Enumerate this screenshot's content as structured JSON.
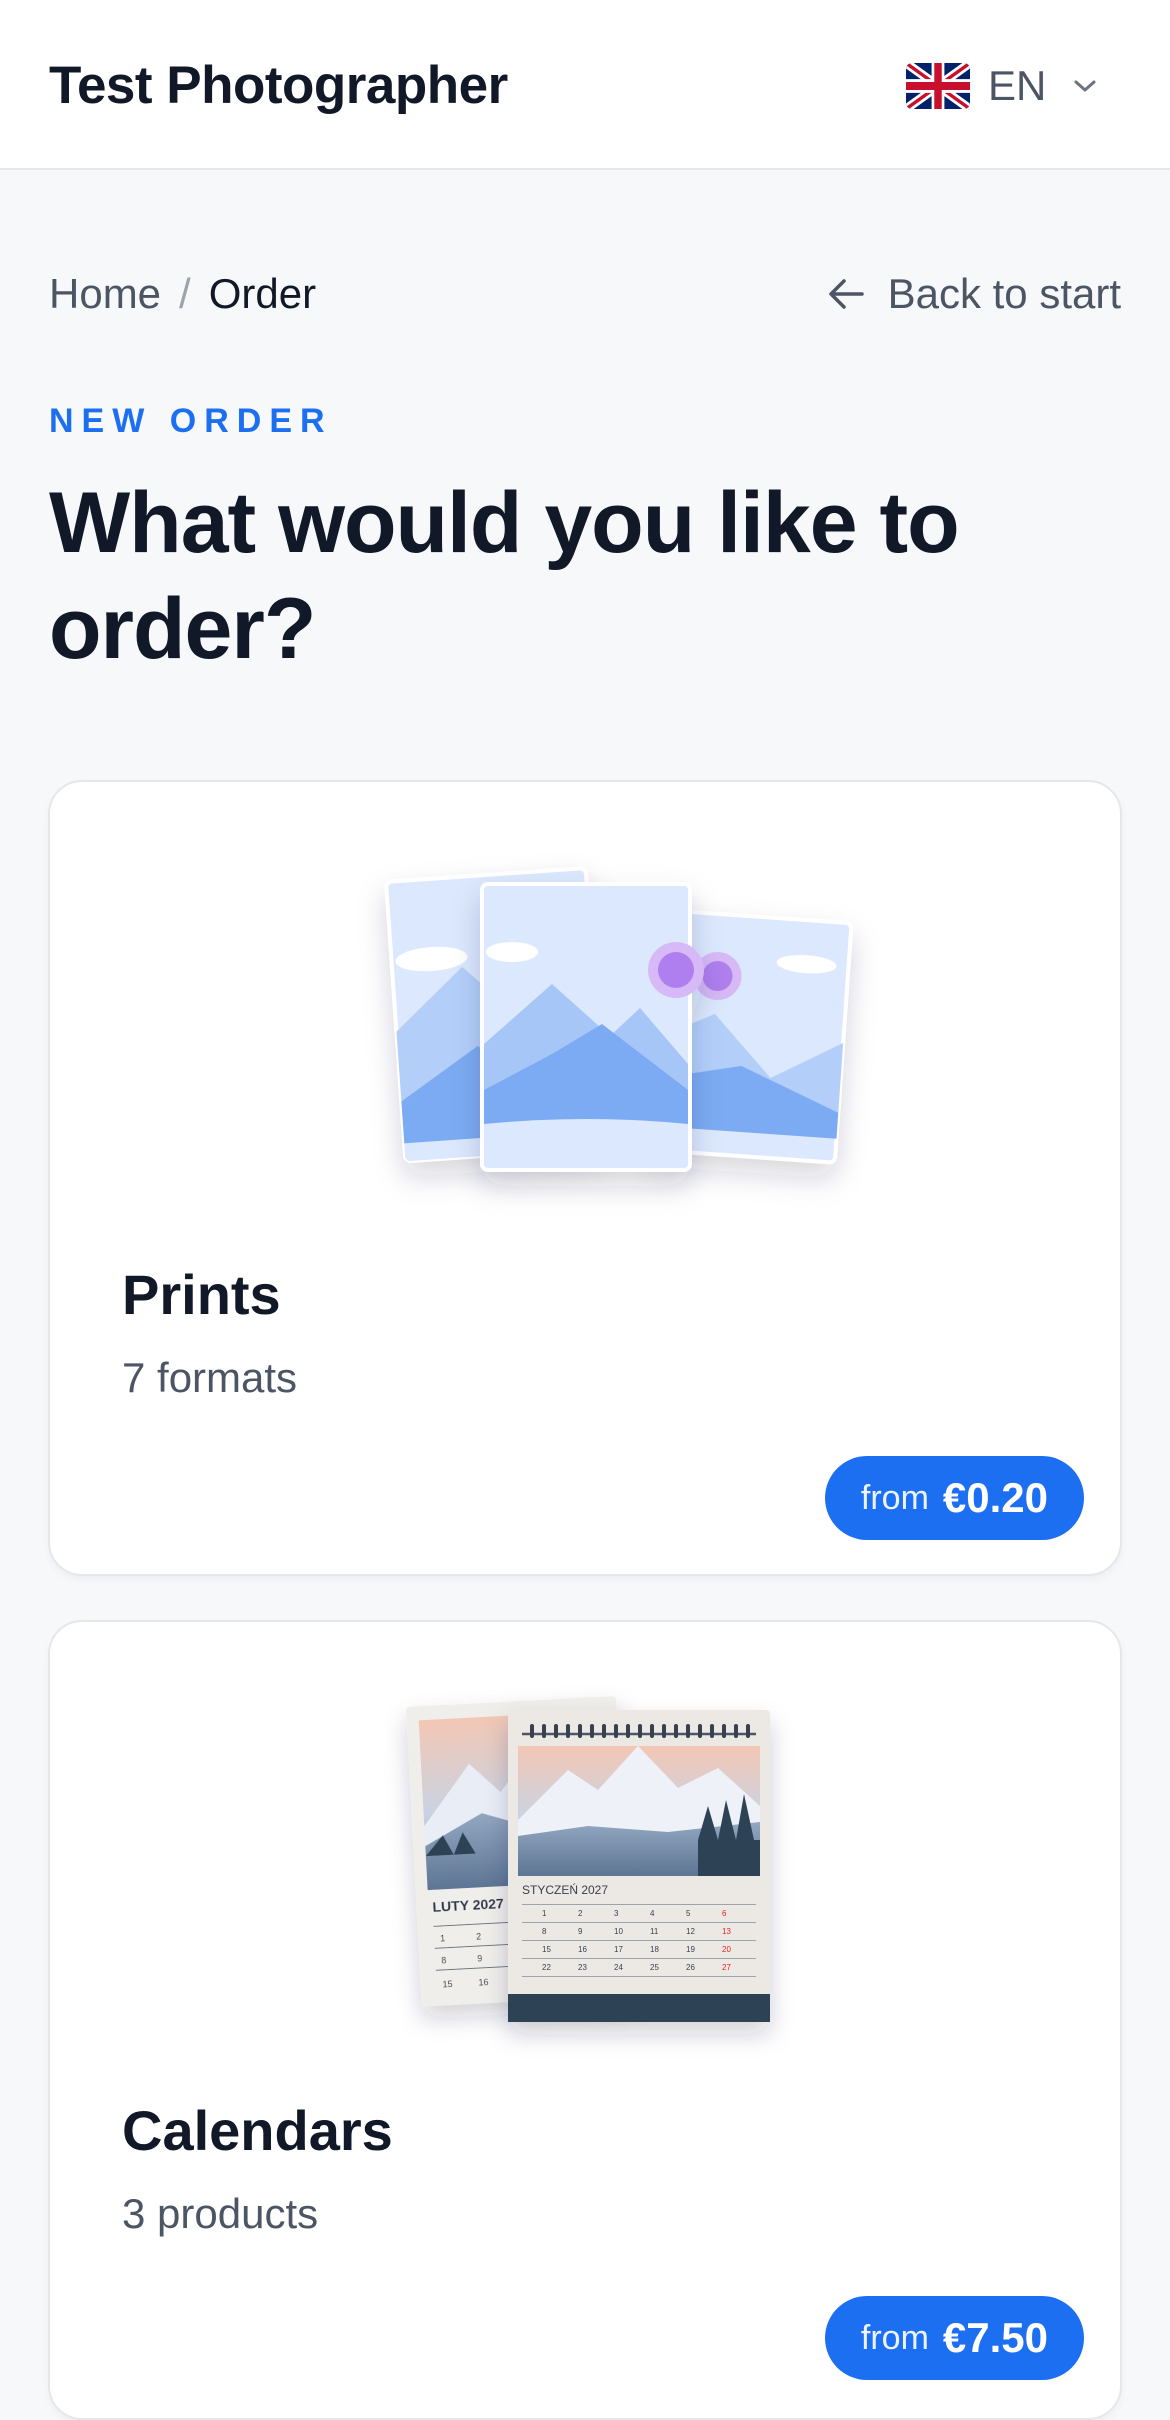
{
  "header": {
    "brand": "Test Photographer",
    "language_code": "EN",
    "language_flag_icon": "uk-flag-icon"
  },
  "breadcrumb": {
    "home": "Home",
    "separator": "/",
    "current": "Order"
  },
  "back_link": "Back to start",
  "eyebrow": "NEW ORDER",
  "heading": "What would you like to order?",
  "products": [
    {
      "title": "Prints",
      "subtitle": "7 formats",
      "price_prefix": "from",
      "price": "€0.20",
      "icon": "prints-illustration"
    },
    {
      "title": "Calendars",
      "subtitle": "3 products",
      "price_prefix": "from",
      "price": "€7.50",
      "icon": "calendars-illustration"
    }
  ],
  "colors": {
    "accent": "#1d6ff2",
    "text": "#111827",
    "muted": "#4b5563",
    "background": "#f7f8fa"
  },
  "calendar_illustration": {
    "back_month": "LUTY 2027",
    "front_month": "STYCZEŃ 2027"
  }
}
